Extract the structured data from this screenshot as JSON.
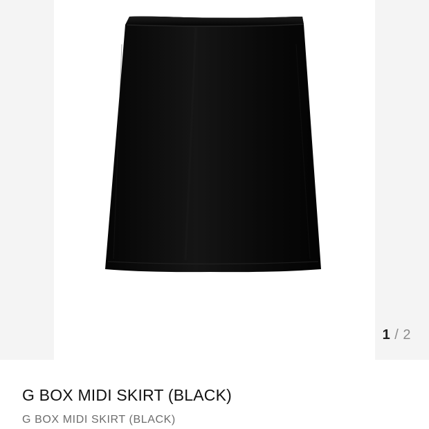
{
  "gallery": {
    "image_icon": "black-midi-skirt-image",
    "current_page": "1",
    "separator": "/",
    "total_pages": "2"
  },
  "product": {
    "title": "G BOX MIDI SKIRT (BLACK)",
    "subtitle": "G BOX MIDI SKIRT  (BLACK)"
  },
  "colors": {
    "page_background": "#ffffff",
    "gallery_background": "#f4f4f4",
    "skirt": "#0d0d0d",
    "title": "#111111",
    "subtitle": "#6d6d6d",
    "pager_current": "#222222",
    "pager_muted": "#8b8b8b"
  }
}
